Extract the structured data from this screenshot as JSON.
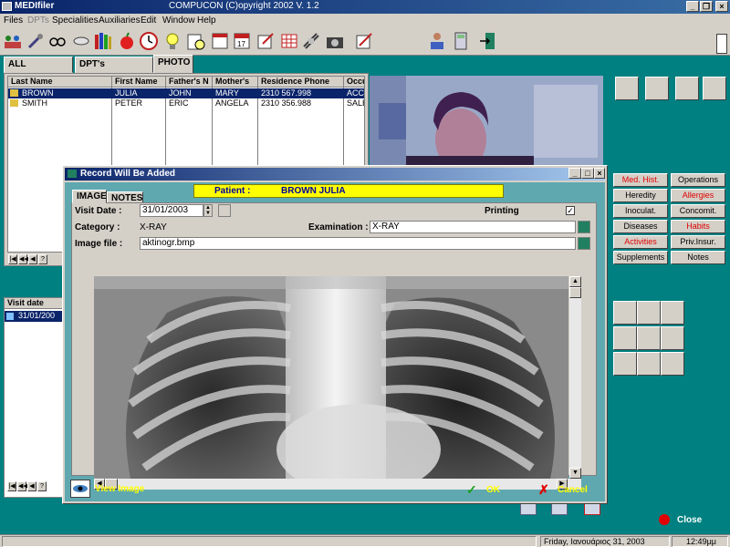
{
  "window": {
    "app_name": "MEDIfiler",
    "copyright": "COMPUCON (C)opyright 2002  V. 1.2"
  },
  "menu": [
    {
      "label": "Files",
      "enabled": true
    },
    {
      "label": "DPTs",
      "enabled": false
    },
    {
      "label": "Specialities",
      "enabled": true
    },
    {
      "label": "Auxiliaries",
      "enabled": true
    },
    {
      "label": "Edit",
      "enabled": true
    },
    {
      "label": "Window",
      "enabled": true
    },
    {
      "label": "Help",
      "enabled": true
    }
  ],
  "main_tabs": [
    "ALL PATIENTS",
    "DPT's PATIENTS",
    "PHOTO"
  ],
  "patients": {
    "columns": [
      "Last Name",
      "First Name",
      "Father's N",
      "Mother's",
      "Residence Phone",
      "Occu"
    ],
    "rows": [
      {
        "last": "BROWN",
        "first": "JULIA",
        "father": "JOHN",
        "mother": "MARY",
        "phone": "2310 567.998",
        "occu": "ACCO"
      },
      {
        "last": "SMITH",
        "first": "PETER",
        "father": "ERIC",
        "mother": "ANGELA",
        "phone": "2310 356.988",
        "occu": "SALE"
      }
    ]
  },
  "visits": {
    "header": "Visit date",
    "rows": [
      "31/01/200"
    ]
  },
  "right_buttons": [
    {
      "label": "Med. Hist.",
      "red": true
    },
    {
      "label": "Operations",
      "red": false
    },
    {
      "label": "Heredity",
      "red": false
    },
    {
      "label": "Allergies",
      "red": true
    },
    {
      "label": "Inoculat.",
      "red": false
    },
    {
      "label": "Concomit.",
      "red": false
    },
    {
      "label": "Diseases",
      "red": false
    },
    {
      "label": "Habits",
      "red": true
    },
    {
      "label": "Activities",
      "red": true
    },
    {
      "label": "Priv.Insur.",
      "red": false
    },
    {
      "label": "Supplements",
      "red": false
    },
    {
      "label": "Notes",
      "red": false
    }
  ],
  "dialog": {
    "title": "Record Will Be Added",
    "tabs": [
      "IMAGE",
      "NOTES"
    ],
    "patient_label": "Patient :",
    "patient_name": "BROWN JULIA",
    "visit_date_label": "Visit Date :",
    "visit_date": "31/01/2003",
    "printing_label": "Printing",
    "category_label": "Category :",
    "category": "X-RAY",
    "examination_label": "Examination :",
    "examination": "X-RAY",
    "image_file_label": "Image file :",
    "image_file": "aktinogr.bmp",
    "view_image": "View Image",
    "ok": "OK",
    "cancel": "Cancel"
  },
  "close_label": "Close",
  "status": {
    "date": "Friday, Ιανουάριος 31, 2003",
    "time": "12:49μμ"
  },
  "colors": {
    "accent_red": "#e00000",
    "banner_yellow": "#ffff00",
    "dialog_teal": "#5fa8b0"
  }
}
